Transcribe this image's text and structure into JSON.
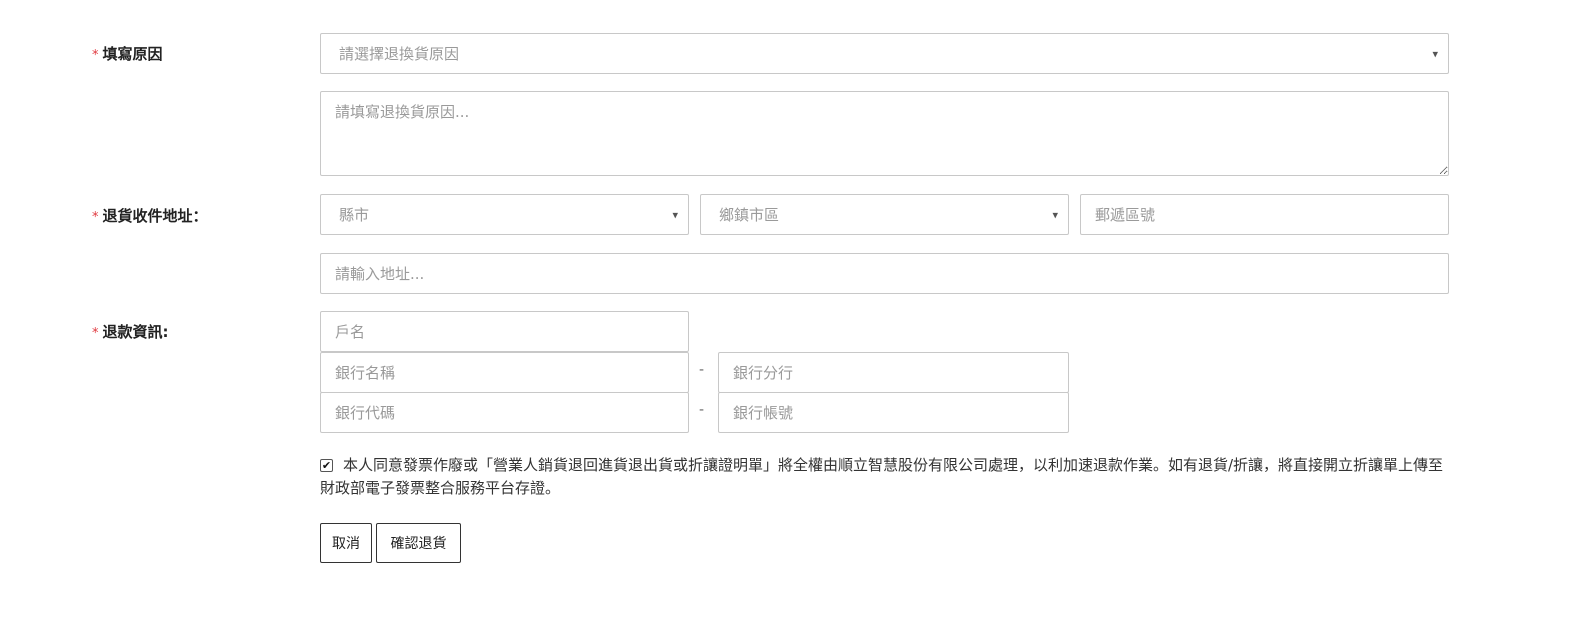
{
  "reason": {
    "required_mark": "*",
    "label": "填寫原因",
    "select_placeholder": "請選擇退換貨原因",
    "textarea_placeholder": "請填寫退換貨原因..."
  },
  "address": {
    "required_mark": "*",
    "label": "退貨收件地址：",
    "city_placeholder": "縣市",
    "district_placeholder": "鄉鎮市區",
    "zip_placeholder": "郵遞區號",
    "street_placeholder": "請輸入地址..."
  },
  "refund": {
    "required_mark": "*",
    "label": "退款資訊:",
    "account_name_placeholder": "戶名",
    "bank_name_placeholder": "銀行名稱",
    "bank_branch_placeholder": "銀行分行",
    "bank_code_placeholder": "銀行代碼",
    "bank_account_placeholder": "銀行帳號",
    "separator": "-"
  },
  "agreement": {
    "checked": true,
    "text": "本人同意發票作廢或「營業人銷貨退回進貨退出貨或折讓證明單」將全權由順立智慧股份有限公司處理，以利加速退款作業。如有退貨/折讓，將直接開立折讓單上傳至財政部電子發票整合服務平台存證。"
  },
  "actions": {
    "cancel_label": "取消",
    "confirm_label": "確認退貨"
  },
  "icons": {
    "select_caret": "▾",
    "checkbox_check": "✔"
  }
}
